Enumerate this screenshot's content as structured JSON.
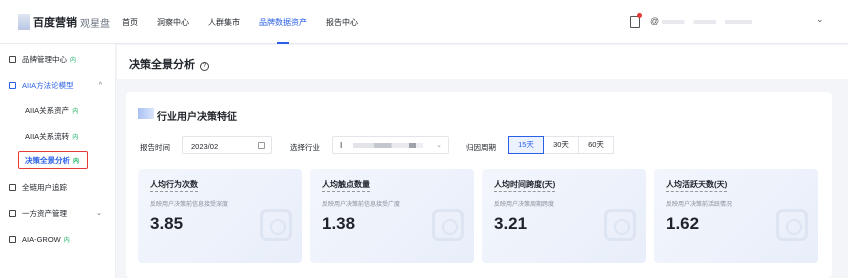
{
  "brand": {
    "name": "百度营销",
    "product": "观星盘"
  },
  "nav": [
    {
      "label": "首页",
      "active": false
    },
    {
      "label": "洞察中心",
      "active": false
    },
    {
      "label": "人群集市",
      "active": false
    },
    {
      "label": "品牌数据资产",
      "active": true
    },
    {
      "label": "报告中心",
      "active": false
    }
  ],
  "user": {
    "at": "@"
  },
  "sidebar": {
    "items": [
      {
        "label": "品牌管理中心",
        "tag": "内",
        "icon": "doc-icon"
      },
      {
        "label": "AIIA方法论模型",
        "icon": "chart-icon",
        "chev": "^"
      },
      {
        "label": "AIIA关系资产",
        "tag": "内"
      },
      {
        "label": "AIIA关系流转",
        "tag": "内"
      },
      {
        "label": "决策全景分析",
        "tag": "内",
        "selected": true
      },
      {
        "label": "全链用户追踪",
        "icon": "link-icon"
      },
      {
        "label": "一方资产管理",
        "icon": "database-icon",
        "chev": "v"
      },
      {
        "label": "AIA-GROW",
        "tag": "内",
        "icon": "grid-icon"
      }
    ]
  },
  "page": {
    "title": "决策全景分析"
  },
  "section": {
    "title": "行业用户决策特征",
    "report_time_label": "报告时间",
    "report_time_value": "2023/02",
    "industry_label": "选择行业",
    "industry_value": "I",
    "period_label": "归因周期",
    "periods": [
      "15天",
      "30天",
      "60天"
    ],
    "active_period": "15天"
  },
  "cards": [
    {
      "title": "人均行为次数",
      "desc": "反映用户决策前信息接受深度",
      "value": "3.85"
    },
    {
      "title": "人均触点数量",
      "desc": "反映用户决策前信息接受广度",
      "value": "1.38"
    },
    {
      "title": "人均时间跨度(天)",
      "desc": "反映用户决策周期跨度",
      "value": "3.21"
    },
    {
      "title": "人均活跃天数(天)",
      "desc": "反映用户决策前活跃情况",
      "value": "1.62"
    }
  ],
  "colors": {
    "accent": "#2a5fe8",
    "tag": "#13b25e",
    "highlight": "#e53935"
  }
}
